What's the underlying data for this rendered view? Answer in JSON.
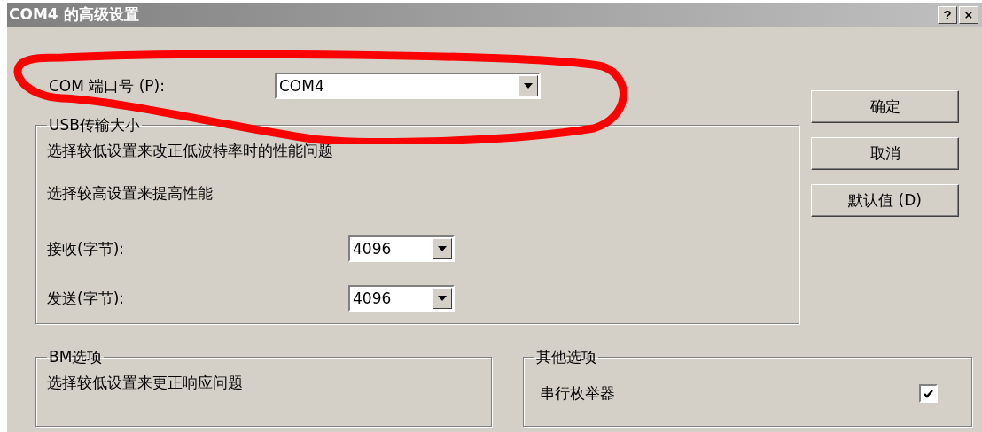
{
  "window": {
    "title": "COM4 的高级设置",
    "controls": [
      "?",
      "×"
    ]
  },
  "port": {
    "label": "COM 端口号 (P):",
    "value": "COM4"
  },
  "buttons": [
    {
      "label": "确定"
    },
    {
      "label": "取消"
    },
    {
      "label": "默认值 (D)"
    }
  ],
  "usb_group": {
    "title": "USB传输大小",
    "lines": [
      "选择较低设置来改正低波特率时的性能问题",
      "选择较高设置来提高性能"
    ],
    "fields": [
      {
        "label": "接收(字节):",
        "value": "4096"
      },
      {
        "label": "发送(字节):",
        "value": "4096"
      }
    ]
  },
  "bm_group": {
    "title": "BM选项",
    "lines": [
      "选择较低设置来更正响应问题"
    ]
  },
  "other_group": {
    "title": "其他选项",
    "options": [
      {
        "label": "串行枚举器",
        "checked": true
      }
    ]
  },
  "annotation": {
    "kind": "ellipse"
  }
}
